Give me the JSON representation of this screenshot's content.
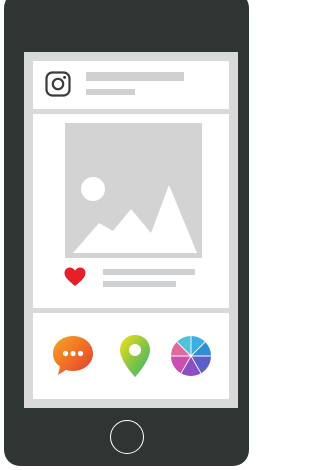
{
  "colors": {
    "phone_body": "#2f3532",
    "screen_bg": "#d9d9d9",
    "panel_bg": "#ffffff",
    "placeholder_bar": "#cfd0d1",
    "heart": "#e52028"
  },
  "icons": {
    "profile": "instagram-icon",
    "photo": "image-placeholder-icon",
    "like": "heart-icon",
    "comment": "chat-bubble-icon",
    "location": "map-pin-icon",
    "stats": "pie-chart-icon"
  }
}
